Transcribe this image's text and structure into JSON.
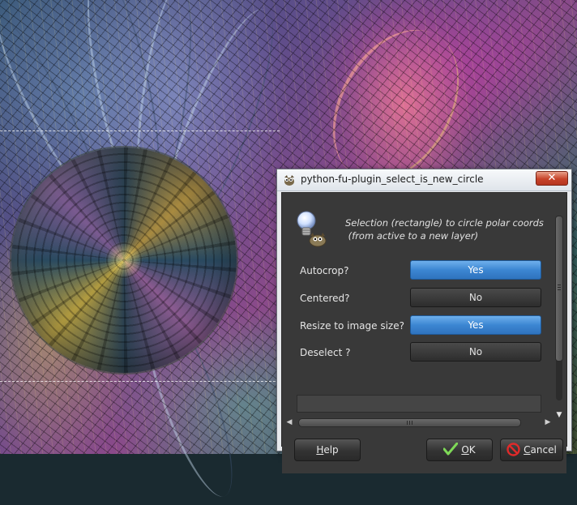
{
  "window": {
    "title": "python-fu-plugin_select_is_new_circle",
    "close_label": "✕"
  },
  "plugin": {
    "description": "Selection (rectangle) to circle polar coords\n (from active to a new layer)"
  },
  "options": [
    {
      "label": "Autocrop?",
      "value": "Yes",
      "state": "on"
    },
    {
      "label": "Centered?",
      "value": "No",
      "state": "off"
    },
    {
      "label": "Resize to image size?",
      "value": "Yes",
      "state": "on"
    },
    {
      "label": "Deselect ?",
      "value": "No",
      "state": "off"
    }
  ],
  "buttons": {
    "help_mnemonic": "H",
    "help_rest": "elp",
    "ok_mnemonic": "O",
    "ok_rest": "K",
    "cancel_mnemonic": "C",
    "cancel_rest": "ancel"
  },
  "scrollbar": {
    "down_arrow": "▼",
    "left_arrow": "◀",
    "right_arrow": "▶"
  },
  "icons": {
    "app": "gimp-icon",
    "plugin": "lightbulb-gimp-icon",
    "ok": "checkmark-icon",
    "cancel": "no-entry-icon"
  },
  "colors": {
    "toggle_on": "#3c86d2",
    "toggle_off": "#2d2d2d",
    "dialog_bg": "#393939",
    "close_red": "#c7432a"
  }
}
